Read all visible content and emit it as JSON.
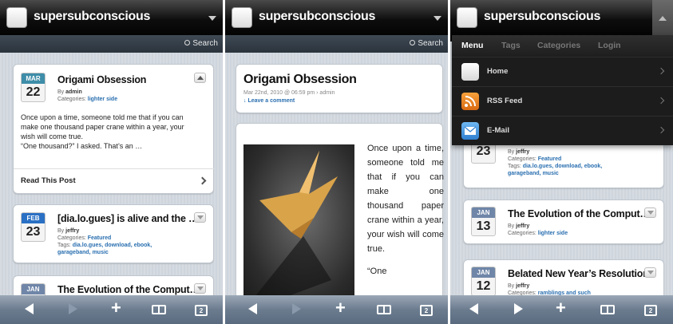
{
  "site": {
    "name": "supersubconscious",
    "search_label": "Search"
  },
  "panel1": {
    "posts": [
      {
        "month": "MAR",
        "day": "22",
        "title": "Origami Obsession",
        "author_prefix": "By",
        "author": "admin",
        "categories_prefix": "Categories:",
        "categories": "lighter side",
        "excerpt": [
          "Once upon a time, someone told me that if you can",
          "make one thousand paper crane within a year, your",
          "wish will come true.",
          "“One thousand?” I asked. That’s an …"
        ],
        "read_label": "Read This Post"
      },
      {
        "month": "FEB",
        "day": "23",
        "title": "[dia.lo.gues] is alive and the …",
        "author_prefix": "By",
        "author": "jeffry",
        "categories_prefix": "Categories:",
        "categories": "Featured",
        "tags_prefix": "Tags:",
        "tags_line1": "dia.lo.gues, download, ebook,",
        "tags_line2": "garageband, music"
      },
      {
        "month": "JAN",
        "title": "The Evolution of the Comput…"
      }
    ]
  },
  "panel2": {
    "title": "Origami Obsession",
    "meta": "Mar 22nd, 2010 @ 06:59 pm › admin",
    "comment_link": "↓ Leave a comment",
    "body": [
      "Once upon a time, someone told me that if you can make one thousand paper crane within a year, your wish will come true.",
      "“One"
    ]
  },
  "panel3": {
    "menu": {
      "tabs": [
        "Menu",
        "Tags",
        "Categories",
        "Login"
      ],
      "active_tab": "Menu",
      "items": [
        {
          "label": "Home",
          "icon": "home-icon"
        },
        {
          "label": "RSS Feed",
          "icon": "rss-icon"
        },
        {
          "label": "E-Mail",
          "icon": "mail-icon"
        }
      ]
    },
    "posts": [
      {
        "day": "23",
        "author_prefix": "By",
        "author": "jeffry",
        "categories_prefix": "Categories:",
        "categories": "Featured",
        "tags_prefix": "Tags:",
        "tags_line1": "dia.lo.gues, download, ebook,",
        "tags_line2": "garageband, music"
      },
      {
        "month": "JAN",
        "day": "13",
        "title": "The Evolution of the Comput…",
        "author_prefix": "By",
        "author": "jeffry",
        "categories_prefix": "Categories:",
        "categories": "lighter side"
      },
      {
        "month": "JAN",
        "day": "12",
        "title": "Belated New Year’s Resolution",
        "author_prefix": "By",
        "author": "jeffry",
        "categories_prefix": "Categories:",
        "categories": "ramblings and such"
      }
    ]
  },
  "toolbar": {
    "tab_count": "2"
  },
  "colors": {
    "header": "#000000",
    "toolbar": "#6c7c8f",
    "link": "#2a6fb0",
    "menu_bg": "#1c1c1c"
  }
}
